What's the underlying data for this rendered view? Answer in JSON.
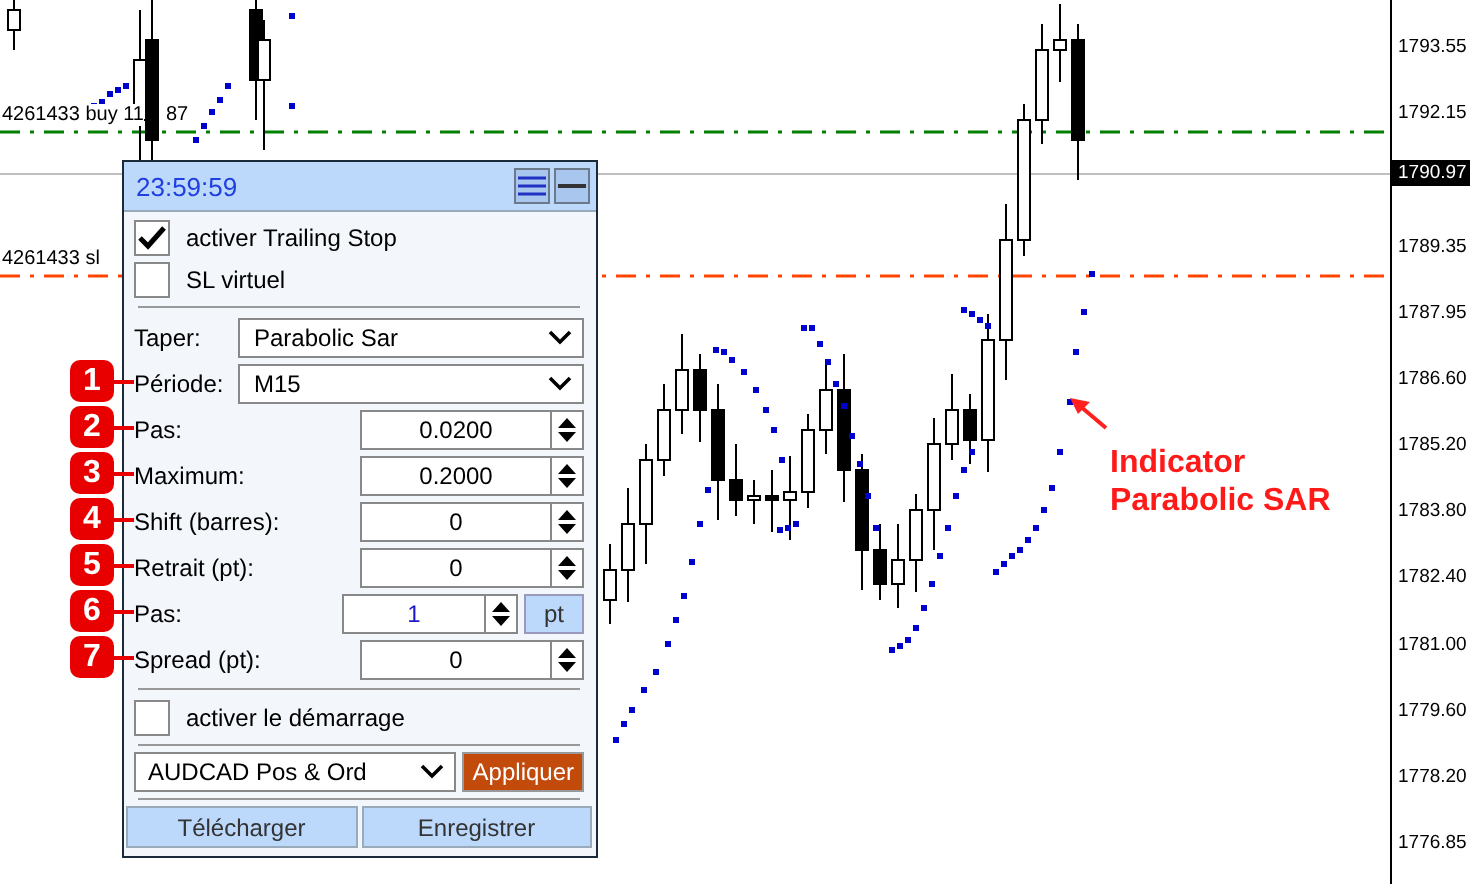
{
  "chart": {
    "price_labels": [
      "1793.55",
      "1792.15",
      "1789.35",
      "1787.95",
      "1786.60",
      "1785.20",
      "1783.80",
      "1782.40",
      "1781.00",
      "1779.60",
      "1778.20",
      "1776.85"
    ],
    "current_price": "1790.97",
    "order_lines": [
      {
        "label": "4261433 buy 11",
        "label_tail": "87",
        "color": "#008000"
      },
      {
        "label": "4261433 sl",
        "color": "#ff4500"
      }
    ],
    "annotation": "Indicator Parabolic SAR"
  },
  "panel": {
    "time": "23:59:59",
    "options": [
      {
        "label": "activer Trailing Stop",
        "checked": true
      },
      {
        "label": "SL virtuel",
        "checked": false
      }
    ],
    "fields": [
      {
        "kind": "select",
        "label": "Taper:",
        "value": "Parabolic Sar"
      },
      {
        "kind": "select",
        "label": "Période:",
        "value": "M15",
        "badge": "1"
      },
      {
        "kind": "spin",
        "label": "Pas:",
        "value": "0.0200",
        "badge": "2"
      },
      {
        "kind": "spin",
        "label": "Maximum:",
        "value": "0.2000",
        "badge": "3"
      },
      {
        "kind": "spin",
        "label": "Shift (barres):",
        "value": "0",
        "badge": "4"
      },
      {
        "kind": "spin",
        "label": "Retrait (pt):",
        "value": "0",
        "badge": "5"
      },
      {
        "kind": "spin_unit",
        "label": "Pas:",
        "value": "1",
        "unit": "pt",
        "badge": "6"
      },
      {
        "kind": "spin",
        "label": "Spread (pt):",
        "value": "0",
        "badge": "7"
      }
    ],
    "start_option": {
      "label": "activer le démarrage",
      "checked": false
    },
    "preset": "AUDCAD Pos & Ord",
    "apply_button": "Appliquer",
    "buttons": [
      "Télécharger",
      "Enregistrer"
    ]
  }
}
